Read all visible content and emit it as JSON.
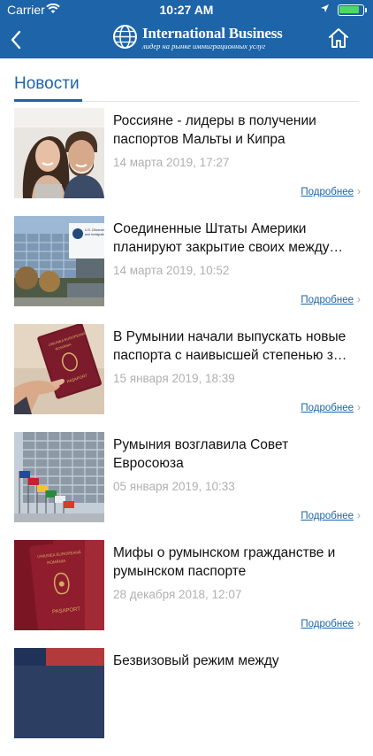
{
  "status_bar": {
    "carrier": "Carrier",
    "time": "10:27 AM"
  },
  "header": {
    "logo_title": "International Business",
    "logo_tagline": "лидер на рынке иммиграционных услуг",
    "icons": [
      "back-chevron-icon",
      "globe-logo-icon",
      "home-icon"
    ],
    "background_color": "#1d64a8"
  },
  "section": {
    "title": "Новости"
  },
  "news": [
    {
      "title": "Россияне - лидеры в получении паспортов Мальты и Кипра",
      "date": "14 марта 2019, 17:27",
      "more": "Подробнее"
    },
    {
      "title": "Соединенные Штаты Америки планируют закрытие своих между…",
      "date": "14 марта 2019, 10:52",
      "more": "Подробнее"
    },
    {
      "title": "В Румынии начали выпускать новые паспорта с наивысшей степенью з…",
      "date": "15 января 2019, 18:39",
      "more": "Подробнее"
    },
    {
      "title": "Румыния возглавила Совет Евросоюза",
      "date": "05 января 2019, 10:33",
      "more": "Подробнее"
    },
    {
      "title": "Мифы о румынском гражданстве и румынском паспорте",
      "date": "28 декабря 2018, 12:07",
      "more": "Подробнее"
    },
    {
      "title": "Безвизовый режим между",
      "date": "",
      "more": ""
    }
  ],
  "thumb_text": {
    "uscis": "U.S. Citizenship and Immigration Services",
    "passport_1": "UNIUNEA EUROPEANĂ ROMÂNIA PAȘAPORT",
    "passport_2": "UNIUNEA EUROPEANĂ ROMÂNIA PAȘAPORT"
  },
  "colors": {
    "accent": "#1d64a8",
    "date": "#b0b0b0",
    "link": "#1d64a8"
  }
}
